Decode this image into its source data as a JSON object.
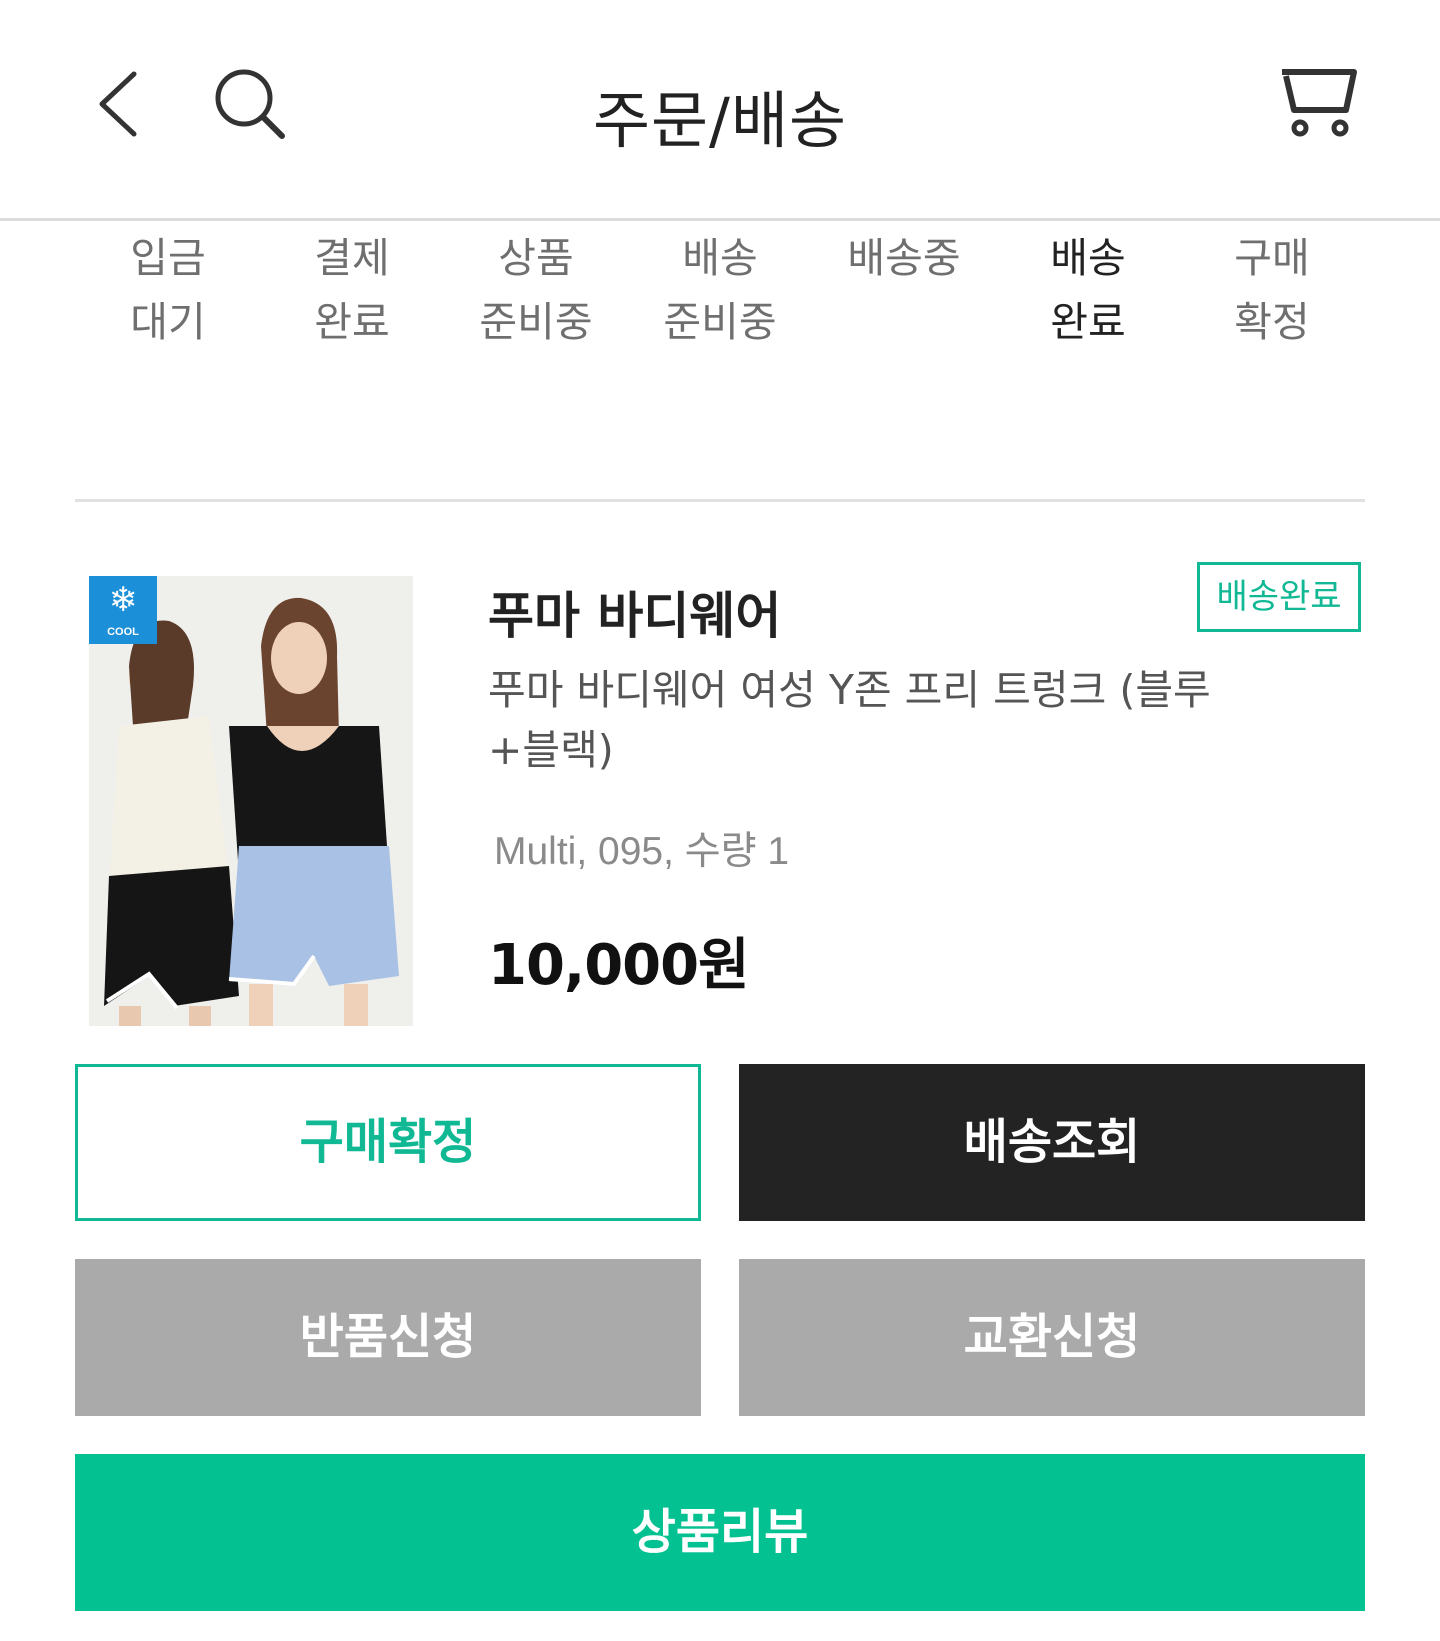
{
  "header": {
    "title": "주문/배송",
    "icons": {
      "back": "chevron-left-icon",
      "search": "search-icon",
      "cart": "cart-icon"
    }
  },
  "status_tabs": [
    {
      "line1": "입금",
      "line2": "대기",
      "active": false
    },
    {
      "line1": "결제",
      "line2": "완료",
      "active": false
    },
    {
      "line1": "상품",
      "line2": "준비중",
      "active": false
    },
    {
      "line1": "배송",
      "line2": "준비중",
      "active": false
    },
    {
      "line1": "배송중",
      "line2": "",
      "active": false
    },
    {
      "line1": "배송",
      "line2": "완료",
      "active": true
    },
    {
      "line1": "구매",
      "line2": "확정",
      "active": false
    }
  ],
  "order": {
    "brand": "푸마 바디웨어",
    "status_badge": "배송완료",
    "product_name": "푸마 바디웨어 여성 Y존 프리 트렁크 (블루+블랙)",
    "option": "Multi, 095, 수량 1",
    "price": "10,000원",
    "image_badge": "COOL"
  },
  "actions": {
    "confirm_purchase": "구매확정",
    "track_delivery": "배송조회",
    "request_return": "반품신청",
    "request_exchange": "교환신청",
    "write_review": "상품리뷰"
  },
  "colors": {
    "accent_green": "#04c192",
    "outline_green": "#10b894",
    "dark_button": "#232323",
    "gray_button": "#aaaaaa"
  }
}
